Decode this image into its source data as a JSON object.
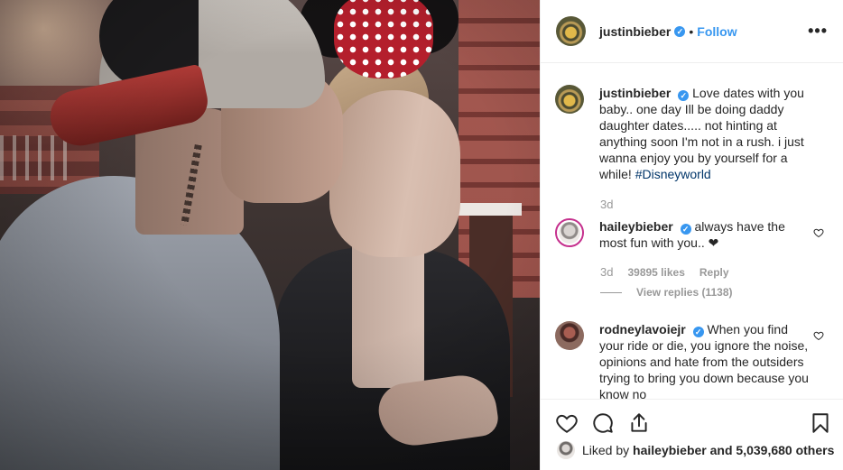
{
  "post": {
    "username": "justinbieber",
    "follow_label": "Follow",
    "separator": "•",
    "more_label": "•••",
    "verified_mark": "✓"
  },
  "caption": {
    "username": "justinbieber",
    "text": "Love dates with you baby.. one day Ill be doing daddy daughter dates..... not hinting at anything soon I'm not in a rush. i just wanna enjoy you by yourself for a while!",
    "hashtag": "#Disneyworld",
    "time": "3d"
  },
  "comments": [
    {
      "username": "haileybieber",
      "text": "always have the most fun with you.. ❤",
      "time": "3d",
      "likes": "39895 likes",
      "reply_label": "Reply",
      "view_replies": "View replies (1138)"
    },
    {
      "username": "rodneylavoiejr",
      "text": "When you find your ride or die, you ignore the noise, opinions and hate from the outsiders trying to bring you down because you know no"
    }
  ],
  "liked_by": {
    "prefix": "Liked by",
    "user": "haileybieber",
    "suffix": "and 5,039,680 others"
  },
  "icons": [
    "heart-icon",
    "comment-icon",
    "share-icon",
    "bookmark-icon",
    "more-options-icon",
    "verified-icon"
  ],
  "colors": {
    "accent": "#3897f0",
    "hashtag": "#003569",
    "muted": "#999999",
    "text": "#262626"
  }
}
